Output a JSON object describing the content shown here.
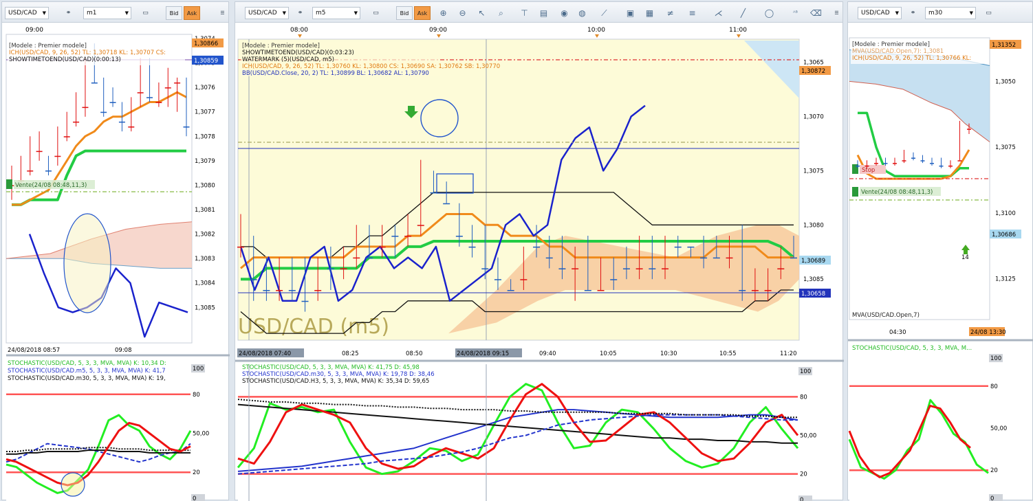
{
  "left": {
    "symbol": "USD/CAD",
    "timeframe": "m1",
    "bid": "Bid",
    "ask": "Ask",
    "time_top": "09:00",
    "legend": [
      "[Modele : Premier modele]",
      "ICH(USD/CAD, 9, 26, 52)  TL: 1,30718  KL: 1,30707  CS:",
      "SHOWTIMETOEND(USD/CAD)(0:00:13)"
    ],
    "yticks": [
      "1,3085",
      "1,3084",
      "1,3083",
      "1,3082",
      "1,3081",
      "1,3080",
      "1,3079",
      "1,3078",
      "1,3077",
      "1,3076",
      "1,3075",
      "1,3074"
    ],
    "price_tag_top": "1,30866",
    "price_tag_cur": "1,30859",
    "vente": "Vente(24/08 08:48,11,3)",
    "xlabels": [
      "24/08/2018 08:57",
      "09:08"
    ],
    "stoch_legend": [
      "STOCHASTIC(USD/CAD, 5, 3, 3, MVA, MVA)  K: 10,34  D:",
      "STOCHASTIC(USD/CAD.m5, 5, 3, 3, MVA, MVA)  K: 41,7",
      "STOCHASTIC(USD/CAD.m30, 5, 3, 3, MVA, MVA)  K: 19,"
    ],
    "stoch_ticks": [
      "100",
      "80",
      "50,00",
      "20",
      "0"
    ]
  },
  "mid": {
    "symbol": "USD/CAD",
    "timeframe": "m5",
    "bid": "Bid",
    "ask": "Ask",
    "time_top": [
      "08:00",
      "09:00",
      "10:00",
      "11:00"
    ],
    "legend": [
      "[Modele : Premier modele]",
      "SHOWTIMETOEND(USD/CAD)(0:03:23)",
      "WATERMARK (5)(USD/CAD, m5)",
      "ICH(USD/CAD, 9, 26, 52)  TL: 1,30760  KL: 1,30800  CS: 1,30690  SA: 1,30762  SB: 1,30770",
      "BB(USD/CAD.Close, 20, 2)  TL: 1,30899  BL: 1,30682  AL: 1,30790"
    ],
    "watermark": "USD/CAD (m5)",
    "yticks": [
      "1,3085",
      "1,3080",
      "1,3075",
      "1,3070",
      "1,3065"
    ],
    "price_tag_top": "1,30872",
    "price_tag_mid": "1,30689",
    "price_tag_low": "1,30658",
    "xlabels": [
      "24/08/2018 07:40",
      "08:25",
      "08:50",
      "24/08/2018 09:15",
      "09:40",
      "10:05",
      "10:30",
      "10:55",
      "11:20"
    ],
    "stoch_legend": [
      "STOCHASTIC(USD/CAD, 5, 3, 3, MVA, MVA)  K: 41,75  D: 45,98",
      "STOCHASTIC(USD/CAD.m30, 5, 3, 3, MVA, MVA)  K: 19,78  D: 38,46",
      "STOCHASTIC(USD/CAD.H3, 5, 3, 3, MVA, MVA)  K: 35,34  D: 59,65"
    ],
    "stoch_ticks": [
      "100",
      "80",
      "50,00",
      "20",
      "0"
    ]
  },
  "right": {
    "symbol": "USD/CAD",
    "timeframe": "m30",
    "legend": [
      "[Modele : Premier modele]",
      "MVA(USD/CAD.Open,7): 1,3081",
      "ICH(USD/CAD, 9, 26, 52)  TL: 1,30766  KL:"
    ],
    "yticks": [
      "1,3125",
      "1,3100",
      "1,3075",
      "1,3050"
    ],
    "price_tag_top": "1,31352",
    "price_tag_cur": "1,30686",
    "stop": "Stop",
    "vente": "Vente(24/08 08:48,11,3)",
    "arrow_label": "14",
    "mva_label": "MVA(USD/CAD.Open,7)",
    "xlabels": [
      "04:30",
      "24/08 13:30"
    ],
    "stoch_legend": [
      "STOCHASTIC(USD/CAD, 5, 3, 3, MVA, M..."
    ],
    "stoch_ticks": [
      "100",
      "80",
      "50,00",
      "20",
      "0"
    ]
  },
  "colors": {
    "bull": "#1f5fbf",
    "bear": "#e01010",
    "ich_tl": "#f08a1a",
    "ich_kl": "#22cc44",
    "price_tag": "#f29a45",
    "blue_tag": "#2255cc",
    "cloud_bull": "#f7c99e",
    "stoch_k": "#22ee22",
    "stoch_d": "#ee1111",
    "level": "#ff5555"
  },
  "chart_data": [
    {
      "type": "candlestick",
      "pane": "m1",
      "ylim": [
        1.3074,
        1.3086
      ],
      "ohlc": [
        [
          1.308,
          1.30806,
          1.30792,
          1.30796
        ],
        [
          1.30798,
          1.308,
          1.30788,
          1.30794
        ],
        [
          1.30794,
          1.30796,
          1.3078,
          1.30786
        ],
        [
          1.30786,
          1.3079,
          1.30778,
          1.3078
        ],
        [
          1.3079,
          1.30796,
          1.30788,
          1.30794
        ],
        [
          1.30788,
          1.30792,
          1.30776,
          1.3078
        ],
        [
          1.3078,
          1.30782,
          1.3077,
          1.30772
        ],
        [
          1.30774,
          1.30776,
          1.30762,
          1.30764
        ],
        [
          1.30768,
          1.30772,
          1.30748,
          1.30752
        ],
        [
          1.3075,
          1.30758,
          1.30742,
          1.30758
        ],
        [
          1.3076,
          1.30772,
          1.30756,
          1.3077
        ],
        [
          1.30764,
          1.30768,
          1.3076,
          1.30766
        ],
        [
          1.3077,
          1.30778,
          1.30766,
          1.30774
        ],
        [
          1.30776,
          1.30778,
          1.30764,
          1.30766
        ],
        [
          1.30762,
          1.30768,
          1.30748,
          1.3075
        ],
        [
          1.3075,
          1.30766,
          1.30748,
          1.30764
        ],
        [
          1.30766,
          1.30768,
          1.30758,
          1.30762
        ],
        [
          1.3076,
          1.30768,
          1.30752,
          1.30756
        ],
        [
          1.30758,
          1.3077,
          1.30756,
          1.30756
        ],
        [
          1.30758,
          1.3078,
          1.30756,
          1.30776
        ]
      ],
      "ich_tl": [
        1.30808,
        1.30808,
        1.30806,
        1.30804,
        1.30802,
        1.30796,
        1.3079,
        1.30784,
        1.3078,
        1.30778,
        1.30774,
        1.30772,
        1.30772,
        1.3077,
        1.30768,
        1.30766,
        1.30766,
        1.30764,
        1.30762,
        1.30764
      ],
      "ich_kl": [
        1.30808,
        1.30808,
        1.30806,
        1.30806,
        1.30806,
        1.30806,
        1.30796,
        1.30788,
        1.30786,
        1.30786,
        1.30786,
        1.30786,
        1.30786,
        1.30786,
        1.30786,
        1.30786,
        1.30786,
        1.30786,
        1.30786,
        1.30786
      ],
      "cs": [
        1.3082,
        1.30836,
        1.3085,
        1.30852,
        1.3085,
        1.30846,
        1.30834,
        1.3084,
        1.30862,
        1.30848,
        1.3085,
        1.30852
      ]
    },
    {
      "type": "candlestick",
      "pane": "m5",
      "ylim": [
        1.3062,
        1.309
      ],
      "ohlc": [
        [
          1.3082,
          1.3083,
          1.3079,
          1.3081
        ],
        [
          1.3081,
          1.3087,
          1.3081,
          1.3085
        ],
        [
          1.3085,
          1.3087,
          1.3083,
          1.3086
        ],
        [
          1.3086,
          1.3087,
          1.3083,
          1.3084
        ],
        [
          1.3084,
          1.3087,
          1.3083,
          1.3086
        ],
        [
          1.3085,
          1.3088,
          1.3083,
          1.3087
        ],
        [
          1.3086,
          1.3087,
          1.3083,
          1.3084
        ],
        [
          1.3084,
          1.3086,
          1.3082,
          1.3084
        ],
        [
          1.3084,
          1.3085,
          1.3082,
          1.3083
        ],
        [
          1.3083,
          1.3084,
          1.308,
          1.3081
        ],
        [
          1.3081,
          1.3083,
          1.308,
          1.3083
        ],
        [
          1.3082,
          1.3083,
          1.308,
          1.3081
        ],
        [
          1.3081,
          1.3083,
          1.308,
          1.3081
        ],
        [
          1.3081,
          1.3082,
          1.3079,
          1.308
        ],
        [
          1.308,
          1.3081,
          1.3074,
          1.3076
        ],
        [
          1.3076,
          1.3077,
          1.3075,
          1.3077
        ],
        [
          1.3076,
          1.3078,
          1.3076,
          1.3078
        ],
        [
          1.3078,
          1.3082,
          1.3078,
          1.3081
        ],
        [
          1.3081,
          1.3083,
          1.308,
          1.3082
        ],
        [
          1.3081,
          1.3085,
          1.308,
          1.3084
        ],
        [
          1.3084,
          1.3086,
          1.3083,
          1.3085
        ],
        [
          1.3085,
          1.3086,
          1.3085,
          1.3086
        ],
        [
          1.3085,
          1.3086,
          1.3082,
          1.3082
        ],
        [
          1.3082,
          1.3083,
          1.308,
          1.3082
        ],
        [
          1.3082,
          1.3084,
          1.3081,
          1.3083
        ],
        [
          1.3082,
          1.3085,
          1.3081,
          1.3084
        ],
        [
          1.3084,
          1.3087,
          1.3082,
          1.3082
        ],
        [
          1.3082,
          1.3086,
          1.3081,
          1.3086
        ],
        [
          1.3086,
          1.3086,
          1.3083,
          1.3084
        ],
        [
          1.3085,
          1.3086,
          1.3083,
          1.3085
        ],
        [
          1.3084,
          1.3085,
          1.3082,
          1.3084
        ],
        [
          1.3084,
          1.3085,
          1.3081,
          1.3081
        ],
        [
          1.3081,
          1.3085,
          1.3081,
          1.3084
        ],
        [
          1.3084,
          1.3085,
          1.3081,
          1.3082
        ],
        [
          1.3082,
          1.3083,
          1.3081,
          1.3082
        ],
        [
          1.3082,
          1.3083,
          1.3082,
          1.3082
        ],
        [
          1.3082,
          1.3084,
          1.3081,
          1.3083
        ],
        [
          1.3082,
          1.3083,
          1.3081,
          1.3083
        ],
        [
          1.3083,
          1.3084,
          1.3081,
          1.3082
        ],
        [
          1.3081,
          1.3087,
          1.308,
          1.3086
        ],
        [
          1.3086,
          1.3087,
          1.3084,
          1.3085
        ],
        [
          1.3086,
          1.3087,
          1.3084,
          1.3085
        ],
        [
          1.3084,
          1.3085,
          1.3082,
          1.3082
        ],
        [
          1.3082,
          1.3083,
          1.3081,
          1.3083
        ]
      ],
      "ich_tl": [
        1.3084,
        1.3083,
        1.3083,
        1.3083,
        1.3083,
        1.3083,
        1.3083,
        1.3083,
        1.3083,
        1.3082,
        1.3082,
        1.3082,
        1.3082,
        1.3081,
        1.3081,
        1.308,
        1.3079,
        1.3079,
        1.3079,
        1.308,
        1.308,
        1.3081,
        1.3081,
        1.3081,
        1.3082,
        1.3082,
        1.3083,
        1.3083,
        1.3083,
        1.3083,
        1.3083,
        1.3083,
        1.3083,
        1.3083,
        1.3083,
        1.3083,
        1.3083,
        1.3082,
        1.3082,
        1.3082,
        1.3082,
        1.3083,
        1.3083,
        1.3083
      ],
      "ich_kl": [
        1.3085,
        1.3085,
        1.3084,
        1.3084,
        1.3084,
        1.3084,
        1.3084,
        1.3084,
        1.3084,
        1.3084,
        1.3083,
        1.3083,
        1.3083,
        1.3082,
        1.3082,
        1.30815,
        1.30815,
        1.30815,
        1.30815,
        1.30815,
        1.30815,
        1.30815,
        1.30815,
        1.30815,
        1.30815,
        1.30815,
        1.30815,
        1.30815,
        1.30815,
        1.30815,
        1.30815,
        1.30815,
        1.30815,
        1.30815,
        1.30815,
        1.30815,
        1.30815,
        1.30815,
        1.30815,
        1.30815,
        1.30815,
        1.30815,
        1.3082,
        1.3083
      ],
      "bb_mid": [
        1.3082,
        1.3082,
        1.3083,
        1.3083,
        1.3083,
        1.3083,
        1.3083,
        1.3083,
        1.3082,
        1.3082,
        1.3081,
        1.3081,
        1.308,
        1.3079,
        1.3078,
        1.3077,
        1.3077,
        1.3077,
        1.3077,
        1.3077,
        1.3077,
        1.3077,
        1.3077,
        1.3077,
        1.3077,
        1.3077,
        1.3077,
        1.3077,
        1.3077,
        1.3077,
        1.3078,
        1.3079,
        1.308,
        1.308,
        1.308,
        1.308,
        1.308,
        1.308,
        1.308,
        1.308,
        1.308,
        1.308,
        1.308,
        1.308
      ],
      "cs": [
        1.3082,
        1.3086,
        1.3083,
        1.3087,
        1.3087,
        1.3083,
        1.3082,
        1.3087,
        1.3086,
        1.3083,
        1.3082,
        1.3084,
        1.3083,
        1.3084,
        1.3082,
        1.3087,
        1.3086,
        1.3085,
        1.3084,
        1.308,
        1.3079,
        1.3081,
        1.308,
        1.3074,
        1.3072,
        1.3071,
        1.3075,
        1.3073,
        1.307,
        1.3069
      ]
    },
    {
      "type": "candlestick",
      "pane": "m30",
      "ylim": [
        1.304,
        1.3135
      ],
      "ohlc": [
        [
          1.3082,
          1.3083,
          1.308,
          1.3082
        ],
        [
          1.3082,
          1.3083,
          1.308,
          1.3081
        ],
        [
          1.3081,
          1.3082,
          1.3079,
          1.308
        ],
        [
          1.308,
          1.3082,
          1.3079,
          1.3081
        ],
        [
          1.3081,
          1.3082,
          1.3079,
          1.308
        ],
        [
          1.308,
          1.3081,
          1.3076,
          1.3078
        ],
        [
          1.3078,
          1.308,
          1.3077,
          1.3079
        ],
        [
          1.3079,
          1.3081,
          1.3078,
          1.308
        ],
        [
          1.308,
          1.3082,
          1.3079,
          1.3081
        ],
        [
          1.3081,
          1.3083,
          1.3079,
          1.3082
        ],
        [
          1.3082,
          1.3083,
          1.308,
          1.308
        ],
        [
          1.308,
          1.308,
          1.3065,
          1.3068
        ],
        [
          1.3068,
          1.307,
          1.3066,
          1.3067
        ]
      ],
      "ich_tl": [
        1.3078,
        1.3085,
        1.3087,
        1.3087,
        1.3087,
        1.3087,
        1.3087,
        1.3087,
        1.3087,
        1.3087,
        1.3086,
        1.3082,
        1.3076
      ],
      "ich_kl": [
        1.3062,
        1.3062,
        1.3075,
        1.3084,
        1.3086,
        1.3086,
        1.3086,
        1.3086,
        1.3086,
        1.3086,
        1.3086,
        1.3083,
        1.3083
      ],
      "mva": [
        1.3035,
        1.3037,
        1.3039,
        1.3041,
        1.3044,
        1.3048,
        1.3052,
        1.306,
        1.3063,
        1.3065,
        1.3069,
        1.3072,
        1.3074
      ]
    },
    {
      "type": "line",
      "pane": "m1 stochastic",
      "ylim": [
        0,
        100
      ],
      "series": [
        {
          "name": "STOCHASTIC(USD/CAD, 5, 3, 3, MVA, MVA)",
          "values": [
            26,
            24,
            18,
            12,
            8,
            4,
            6,
            14,
            22,
            40,
            60,
            64,
            56,
            52,
            40,
            34,
            30,
            38,
            52
          ]
        },
        {
          "name": "STOCHASTIC(USD/CAD.m5, 5, 3, 3, MVA, MVA)",
          "values": [
            28,
            30,
            34,
            38,
            42,
            41,
            40,
            39,
            38,
            36,
            34,
            32,
            30,
            28,
            30,
            33,
            35,
            36,
            42
          ]
        },
        {
          "name": "STOCHASTIC(USD/CAD.m30, 5, 3, 3, MVA, MVA)",
          "values": [
            34,
            34,
            35,
            35,
            36,
            36,
            36,
            36,
            37,
            37,
            37,
            36,
            36,
            36,
            35,
            35,
            35,
            35,
            35
          ]
        }
      ]
    },
    {
      "type": "line",
      "pane": "m5 stochastic",
      "ylim": [
        0,
        100
      ],
      "series": [
        {
          "name": "STOCHASTIC(USD/CAD, 5, 3, 3, MVA, MVA)",
          "values": [
            25,
            40,
            75,
            70,
            72,
            68,
            70,
            45,
            25,
            20,
            22,
            30,
            40,
            38,
            30,
            35,
            58,
            80,
            90,
            85,
            60,
            40,
            42,
            60,
            70,
            68,
            55,
            40,
            30,
            25,
            28,
            40,
            60,
            72,
            55,
            40
          ]
        },
        {
          "name": "STOCHASTIC(USD/CAD.m30, 5, 3, 3, MVA, MVA)",
          "values": [
            22,
            23,
            24,
            25,
            26,
            28,
            30,
            32,
            34,
            36,
            38,
            40,
            44,
            48,
            52,
            56,
            60,
            64,
            66,
            68,
            70,
            70,
            69,
            68,
            67,
            66,
            65,
            64,
            64,
            64,
            64,
            65,
            66,
            66,
            64,
            62
          ]
        },
        {
          "name": "STOCHASTIC(USD/CAD.H3, 5, 3, 3, MVA, MVA)",
          "values": [
            74,
            73,
            72,
            71,
            70,
            69,
            68,
            67,
            66,
            65,
            64,
            63,
            62,
            61,
            60,
            59,
            58,
            57,
            56,
            55,
            54,
            53,
            52,
            51,
            50,
            49,
            48,
            48,
            47,
            47,
            46,
            46,
            45,
            45,
            44,
            44
          ]
        }
      ]
    },
    {
      "type": "line",
      "pane": "m30 stochastic",
      "ylim": [
        0,
        100
      ],
      "series": [
        {
          "name": "STOCHASTIC(USD/CAD, 5, 3, 3, MVA, M...",
          "values": [
            42,
            22,
            18,
            14,
            20,
            34,
            42,
            70,
            60,
            46,
            40,
            24,
            18
          ]
        }
      ]
    }
  ]
}
